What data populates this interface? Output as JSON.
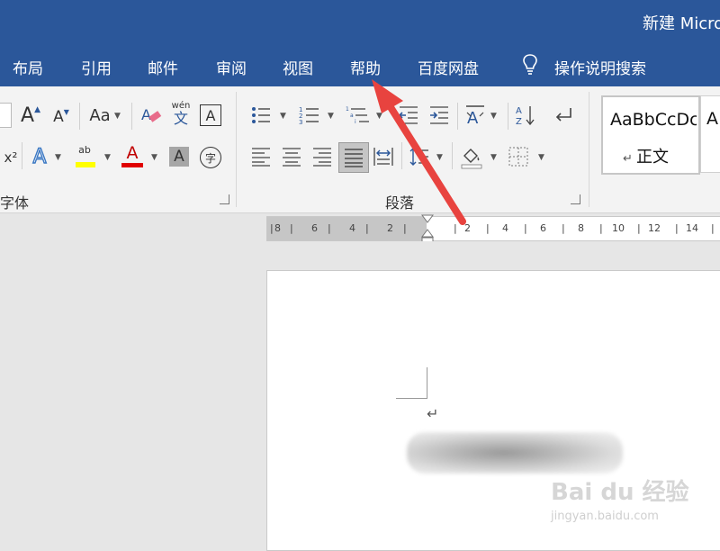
{
  "window": {
    "title": "新建 Micro"
  },
  "tabs": [
    {
      "label": "布局"
    },
    {
      "label": "引用"
    },
    {
      "label": "邮件"
    },
    {
      "label": "审阅"
    },
    {
      "label": "视图"
    },
    {
      "label": "帮助"
    },
    {
      "label": "百度网盘"
    }
  ],
  "tell_me": {
    "label": "操作说明搜索",
    "icon": "lightbulb-icon"
  },
  "ribbon": {
    "font_group": {
      "label": "字体",
      "grow_font_glyph": "A",
      "shrink_font_glyph": "A",
      "change_case_glyph": "Aa",
      "phonetic_glyph_top": "wén",
      "phonetic_glyph_bottom": "文",
      "char_border_glyph": "A",
      "superscript_glyph": "x²",
      "text_effects_glyph": "A",
      "highlight_glyph": "ab",
      "font_color_glyph": "A",
      "char_shading_glyph": "A",
      "enclose_char_glyph": "字",
      "highlight_color": "#ffff00",
      "font_color": "#e00000"
    },
    "paragraph_group": {
      "label": "段落"
    },
    "styles": {
      "sample": "AaBbCcDc",
      "name": "正文"
    }
  },
  "ruler": {
    "labels_left": [
      "8",
      "6",
      "4",
      "2"
    ],
    "labels_right": [
      "2",
      "4",
      "6",
      "8",
      "10",
      "12",
      "14"
    ]
  },
  "document": {
    "paragraph_mark": "↵"
  },
  "watermark": {
    "logo": "Bai du 经验",
    "url": "jingyan.baidu.com"
  },
  "colors": {
    "accent": "#2b579a",
    "arrow": "#e8433f"
  }
}
